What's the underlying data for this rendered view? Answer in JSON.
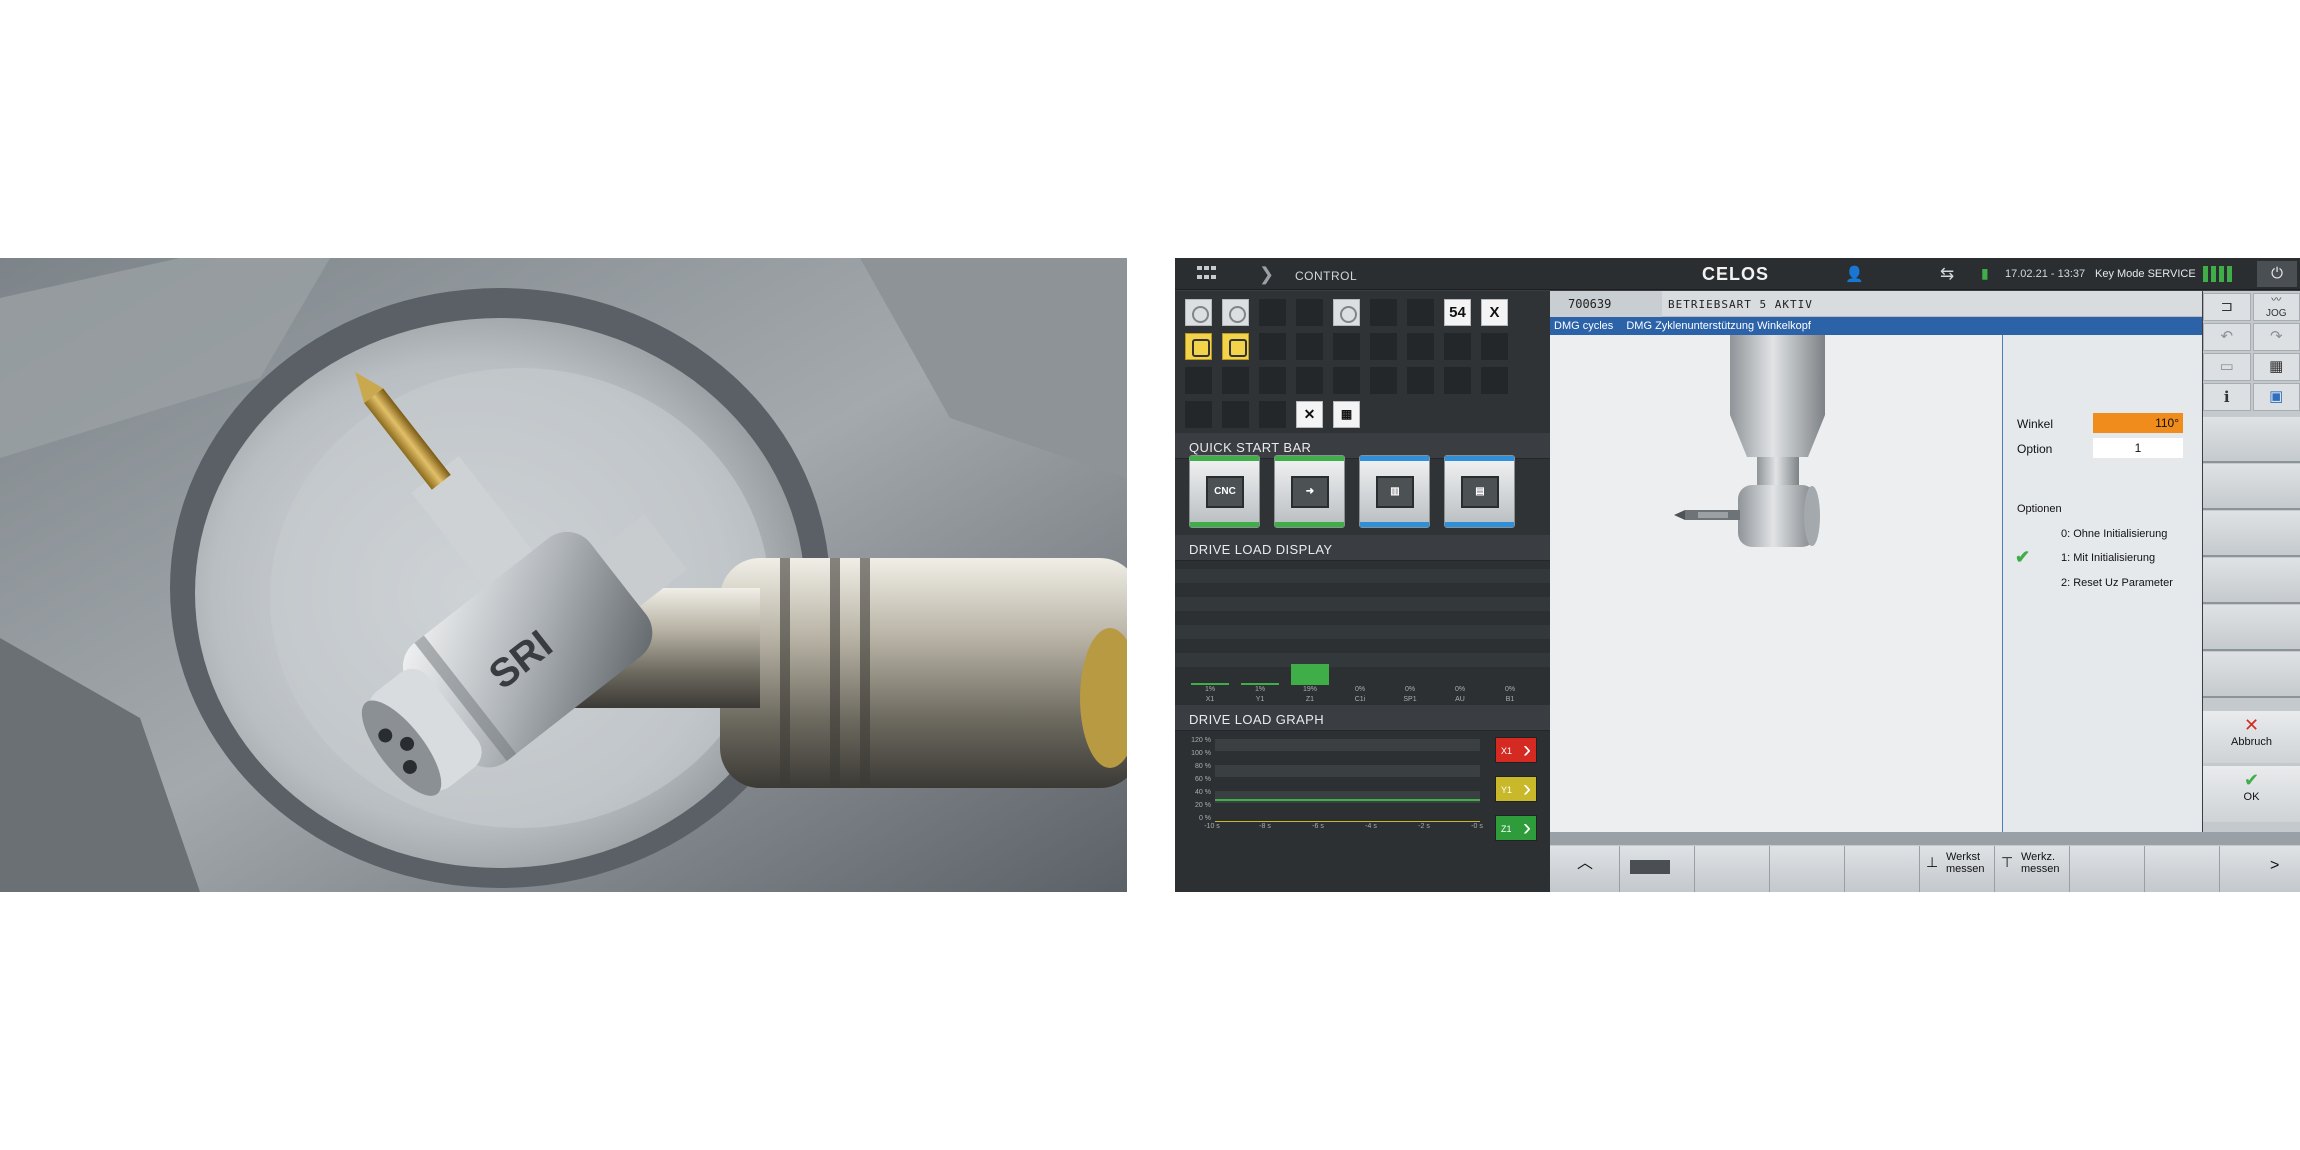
{
  "photo": {
    "tool_marking": "SRI"
  },
  "topbar": {
    "section": "CONTROL",
    "brand": "CELOS",
    "datetime": "17.02.21 - 13:37",
    "key_mode": "Key Mode SERVICE"
  },
  "status_icons": {
    "work_offset": "54",
    "axis": "X"
  },
  "quick_start": {
    "title": "QUICK START BAR",
    "cnc_label": "CNC",
    "accent_green": "#3fae49",
    "accent_blue": "#2f8fd8"
  },
  "drive_load": {
    "title": "DRIVE LOAD DISPLAY",
    "axes": [
      "X1",
      "Y1",
      "Z1",
      "C1i",
      "SP1",
      "AU",
      "B1"
    ],
    "values_pct": [
      1,
      1,
      19,
      0,
      0,
      0,
      0
    ],
    "labels": [
      "1%",
      "1%",
      "19%",
      "0%",
      "0%",
      "0%",
      "0%"
    ]
  },
  "graph": {
    "title": "DRIVE LOAD GRAPH",
    "y_ticks": [
      "120 %",
      "100 %",
      "80 %",
      "60 %",
      "40 %",
      "20 %",
      "0 %"
    ],
    "x_ticks": [
      "-10 s",
      "-8 s",
      "-6 s",
      "-4 s",
      "-2 s",
      "-0 s"
    ],
    "buttons": [
      {
        "label": "X1",
        "color": "#d42a22"
      },
      {
        "label": "Y1",
        "color": "#c9b82a"
      },
      {
        "label": "Z1",
        "color": "#2e9c3a"
      }
    ]
  },
  "program": {
    "number": "700639",
    "mode": "BETRIEBSART 5 AKTIV"
  },
  "breadcrumb": {
    "cycles": "DMG cycles",
    "title": "DMG Zyklenunterstützung Winkelkopf"
  },
  "params": {
    "winkel_label": "Winkel",
    "winkel_value": "110°",
    "option_label": "Option",
    "option_value": "1",
    "options_title": "Optionen",
    "options": [
      "0: Ohne Initialisierung",
      "1: Mit Initialisierung",
      "2: Reset Uz Parameter"
    ],
    "selected_index": 1,
    "highlight_color": "#f08c1c"
  },
  "softkeys": {
    "werkst_line1": "Werkst",
    "werkst_line2": "messen",
    "werkz_line1": "Werkz.",
    "werkz_line2": "messen",
    "next": ">"
  },
  "sidebar": {
    "jog": "JOG",
    "info": "i",
    "abbruch": "Abbruch",
    "ok": "OK"
  }
}
